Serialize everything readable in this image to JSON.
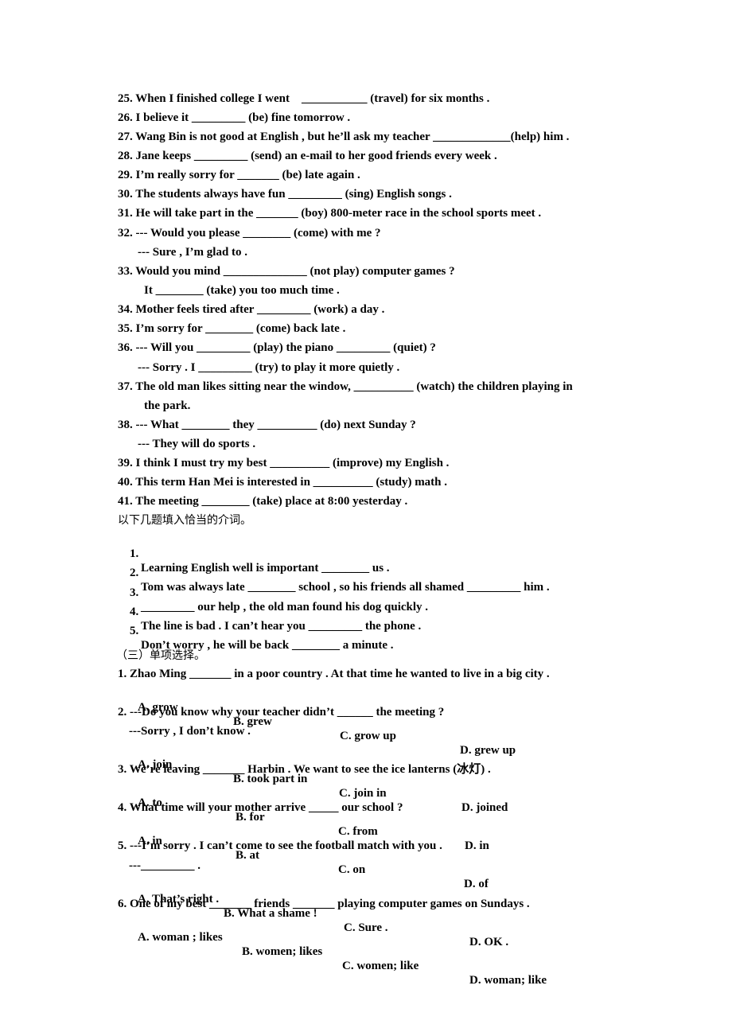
{
  "fill_in": [
    "25. When I finished college I went    ___________ (travel) for six months .",
    "26. I believe it _________ (be) fine tomorrow .",
    "27. Wang Bin is not good at English , but he’ll ask my teacher _____________(help) him .",
    "28. Jane keeps _________ (send) an e-mail to her good friends every week .",
    "29. I’m really sorry for _______ (be) late again .",
    "30. The students always have fun _________ (sing) English songs .",
    "31. He will take part in the _______ (boy) 800-meter race in the school sports meet .",
    "32. --- Would you please ________ (come) with me ?",
    "--- Sure , I’m glad to .",
    "33. Would you mind ______________ (not play) computer games ?",
    "It ________ (take) you too much time .",
    "34. Mother feels tired after _________ (work) a day .",
    "35. I’m sorry for ________ (come) back late .",
    "36. --- Will you _________ (play) the piano _________ (quiet) ?",
    "--- Sorry . I _________ (try) to play it more quietly .",
    "37. The old man likes sitting near the window, __________ (watch) the children playing in",
    "the park.",
    "38. --- What ________ they __________ (do) next Sunday ?",
    "--- They will do sports .",
    "39. I think I must try my best __________ (improve) my English .",
    "40. This term Han Mei is interested in __________ (study) math .",
    "41. The meeting ________ (take) place at 8:00 yesterday ."
  ],
  "prepositions": {
    "instruction": "以下几题填入恰当的介词。",
    "items": [
      {
        "num": "1.",
        "text": "Learning English well is important ________ us ."
      },
      {
        "num": "2.",
        "text": "Tom was always late ________ school , so his friends all shamed _________ him ."
      },
      {
        "num": "3.",
        "text": "_________ our help , the old man found his dog quickly ."
      },
      {
        "num": "4.",
        "text": "The line is bad . I can’t hear you _________ the phone ."
      },
      {
        "num": "5.",
        "text": "Don’t worry , he will be back ________ a minute ."
      }
    ]
  },
  "multiple_choice": {
    "heading": "（三）单项选择。",
    "questions": [
      {
        "stem": [
          "1. Zhao Ming _______ in a poor country . At that time he wanted to live in a big city ."
        ],
        "options": [
          "A. grow",
          "B. grew",
          "C. grow up",
          "D. grew up"
        ]
      },
      {
        "stem": [
          "2. ---Do you know why your teacher didn’t ______ the meeting ?",
          "---Sorry , I don’t know ."
        ],
        "options": [
          "A. join",
          "B. took part in",
          "C. join in",
          "D. joined"
        ]
      },
      {
        "stem": [
          "3. We’re leaving _______ Harbin . We want to see the ice lanterns (冰灯) ."
        ],
        "options": [
          "A. to",
          "B. for",
          "C. from",
          "D. in"
        ]
      },
      {
        "stem": [
          "4. What time will your mother arrive _____ our school ?"
        ],
        "options": [
          "A. in",
          "B. at",
          "C. on",
          "D. of"
        ]
      },
      {
        "stem": [
          "5. ---I’m sorry . I can’t come to see the football match with you .",
          "---_________ ."
        ],
        "options": [
          "A. That’s right .",
          "B. What a shame !",
          "C. Sure .",
          "D. OK ."
        ]
      },
      {
        "stem": [
          "6. One of my best _______ friends _______ playing computer games on Sundays ."
        ],
        "options": [
          "A. woman ; likes",
          "B. women; likes",
          "C. women; like",
          "D. woman; like"
        ]
      }
    ]
  }
}
